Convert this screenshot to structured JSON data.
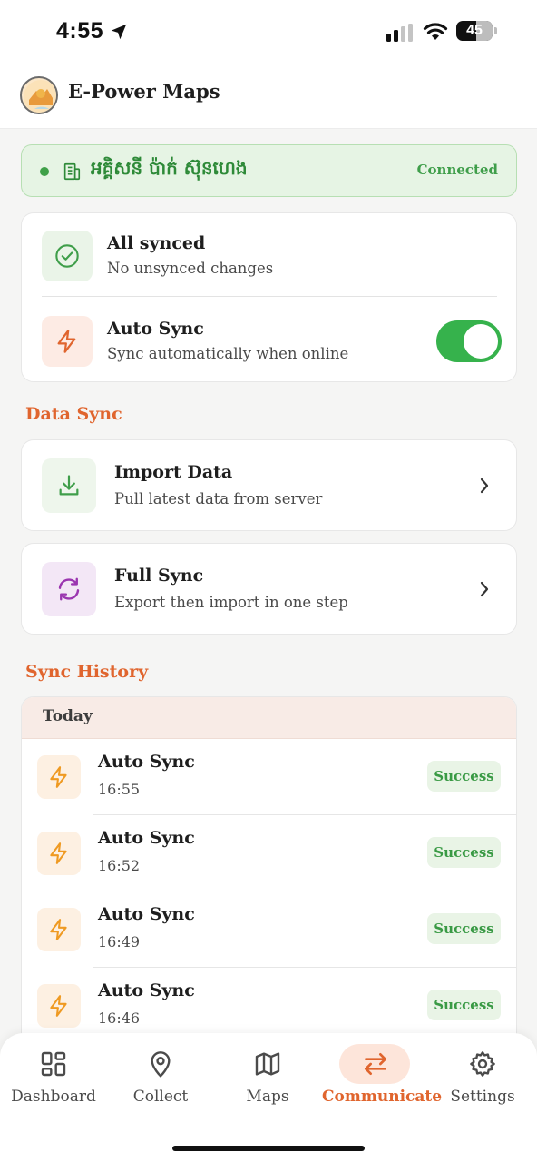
{
  "status_bar": {
    "time": "4:55",
    "battery": "45"
  },
  "header": {
    "title": "E-Power Maps"
  },
  "connection": {
    "name": "អគ្គិសនី ប៉ាក់ ស៊ុនហេង",
    "status": "Connected"
  },
  "sync_status": {
    "title": "All synced",
    "subtitle": "No unsynced changes",
    "auto_sync_title": "Auto Sync",
    "auto_sync_subtitle": "Sync automatically when online",
    "auto_sync_enabled": true
  },
  "data_sync": {
    "section_title": "Data Sync",
    "items": [
      {
        "title": "Import Data",
        "subtitle": "Pull latest data from server"
      },
      {
        "title": "Full Sync",
        "subtitle": "Export then import in one step"
      }
    ]
  },
  "history": {
    "section_title": "Sync History",
    "group_label": "Today",
    "rows": [
      {
        "title": "Auto Sync",
        "time": "16:55",
        "status": "Success"
      },
      {
        "title": "Auto Sync",
        "time": "16:52",
        "status": "Success"
      },
      {
        "title": "Auto Sync",
        "time": "16:49",
        "status": "Success"
      },
      {
        "title": "Auto Sync",
        "time": "16:46",
        "status": "Success"
      }
    ]
  },
  "tabs": [
    {
      "label": "Dashboard",
      "icon": "dashboard-grid-icon"
    },
    {
      "label": "Collect",
      "icon": "map-pin-icon"
    },
    {
      "label": "Maps",
      "icon": "map-icon"
    },
    {
      "label": "Communicate",
      "icon": "swap-arrows-icon",
      "active": true
    },
    {
      "label": "Settings",
      "icon": "gear-icon"
    }
  ],
  "colors": {
    "accent": "#e0652e",
    "success": "#36b24c",
    "connected_bg": "#e6f4e4"
  }
}
